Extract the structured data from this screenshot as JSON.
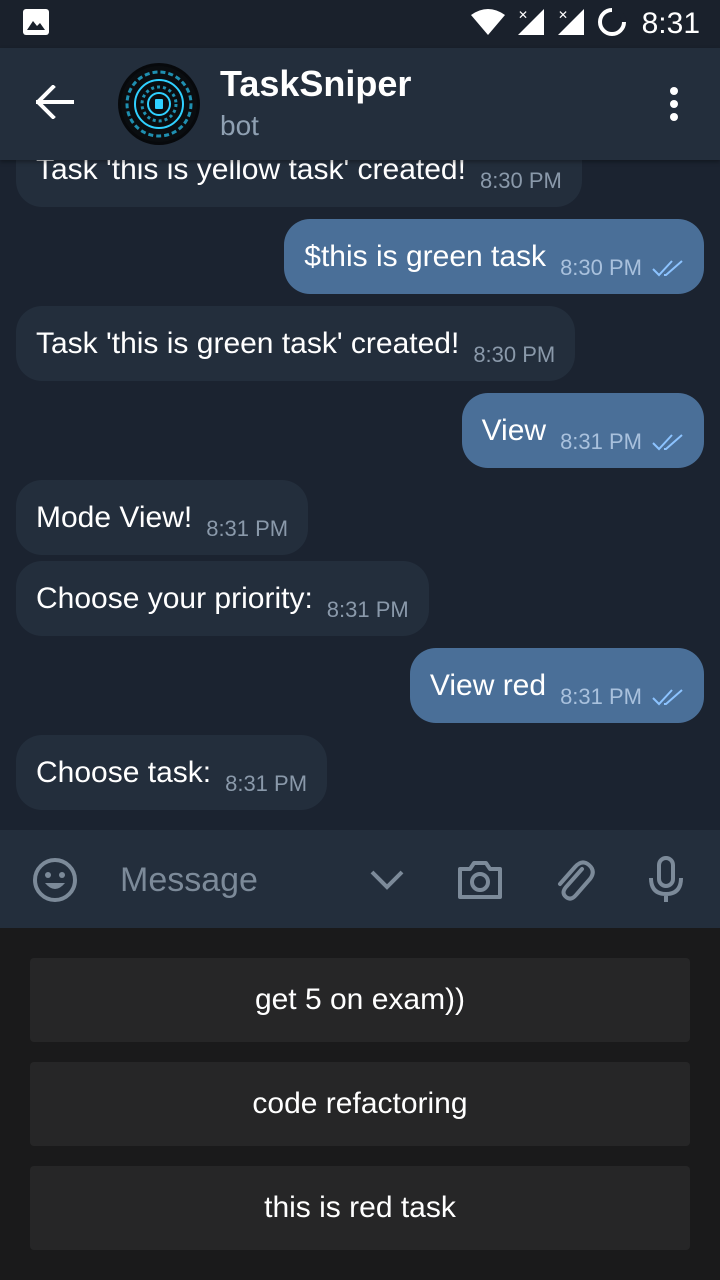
{
  "status_bar": {
    "time": "8:31",
    "icons": [
      "image-icon",
      "wifi-icon",
      "signal-icon",
      "signal-icon",
      "battery-icon"
    ]
  },
  "header": {
    "title": "TaskSniper",
    "subtitle": "bot",
    "back_icon": "arrow-left-icon",
    "menu_icon": "more-vertical-icon"
  },
  "messages": [
    {
      "direction": "in",
      "text": "Task 'this is yellow task' created!",
      "time": "8:30 PM"
    },
    {
      "direction": "out",
      "text": "$this is green task",
      "time": "8:30 PM",
      "read": true
    },
    {
      "direction": "in",
      "text": "Task 'this is green task' created!",
      "time": "8:30 PM"
    },
    {
      "direction": "out",
      "text": "View",
      "time": "8:31 PM",
      "read": true
    },
    {
      "direction": "in",
      "text": "Mode View!",
      "time": "8:31 PM"
    },
    {
      "direction": "in",
      "text": "Choose your priority:",
      "time": "8:31 PM"
    },
    {
      "direction": "out",
      "text": "View red",
      "time": "8:31 PM",
      "read": true
    },
    {
      "direction": "in",
      "text": "Choose task:",
      "time": "8:31 PM"
    }
  ],
  "input": {
    "placeholder": "Message",
    "icons": [
      "emoji-icon",
      "chevron-down-icon",
      "camera-icon",
      "paperclip-icon",
      "microphone-icon"
    ]
  },
  "keyboard": {
    "buttons": [
      "get 5 on exam))",
      "code refactoring",
      "this is red task"
    ]
  },
  "colors": {
    "background": "#1b2330",
    "header": "#232e3c",
    "incoming_bubble": "#232e3c",
    "outgoing_bubble": "#4a6f98",
    "read_ticks": "#8cc3ff",
    "keyboard_bg": "#1a1a1b",
    "keyboard_button": "#262627"
  }
}
